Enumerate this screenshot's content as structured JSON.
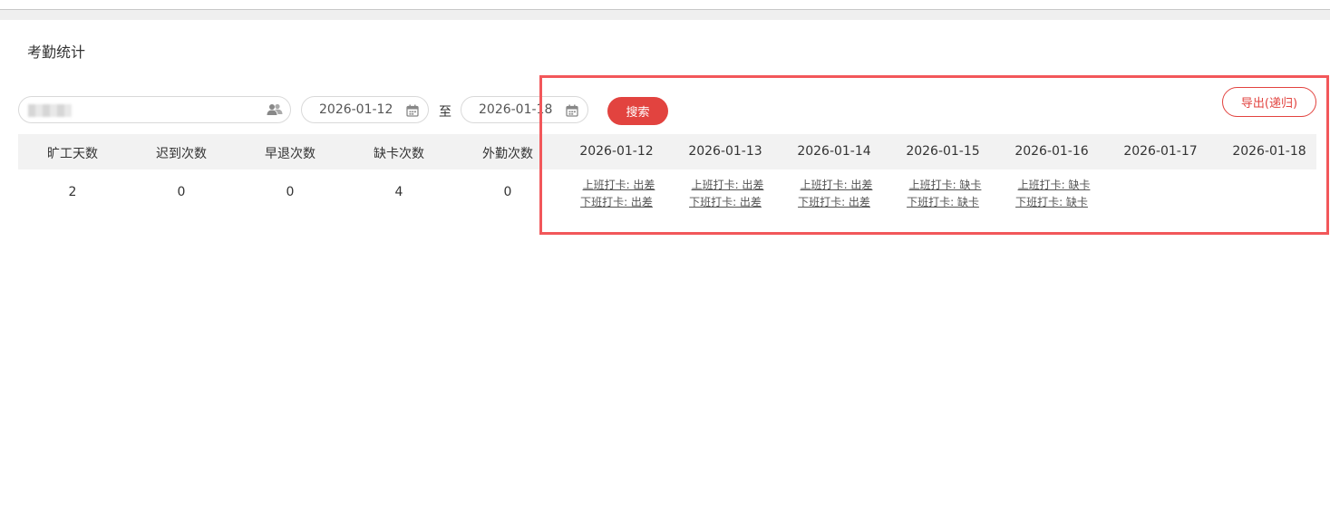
{
  "page": {
    "title": "考勤统计"
  },
  "filters": {
    "start_date": "2026-01-12",
    "to_label": "至",
    "end_date": "2026-01-18",
    "search_label": "搜索",
    "export_label": "导出(递归)"
  },
  "table": {
    "headers": [
      "旷工天数",
      "迟到次数",
      "早退次数",
      "缺卡次数",
      "外勤次数",
      "2026-01-12",
      "2026-01-13",
      "2026-01-14",
      "2026-01-15",
      "2026-01-16",
      "2026-01-17",
      "2026-01-18"
    ],
    "summary": [
      "2",
      "0",
      "0",
      "4",
      "0"
    ],
    "days": [
      {
        "in": "上班打卡: 出差",
        "out": "下班打卡: 出差"
      },
      {
        "in": "上班打卡: 出差",
        "out": "下班打卡: 出差"
      },
      {
        "in": "上班打卡: 出差",
        "out": "下班打卡: 出差"
      },
      {
        "in": "上班打卡: 缺卡",
        "out": "下班打卡: 缺卡"
      },
      {
        "in": "上班打卡: 缺卡",
        "out": "下班打卡: 缺卡"
      }
    ]
  },
  "colors": {
    "accent": "#e2433f",
    "highlight": "#f2575a",
    "header_bg": "#f2f2f2"
  },
  "icons": {
    "user_picker": "users-icon",
    "date": "calendar-icon"
  }
}
